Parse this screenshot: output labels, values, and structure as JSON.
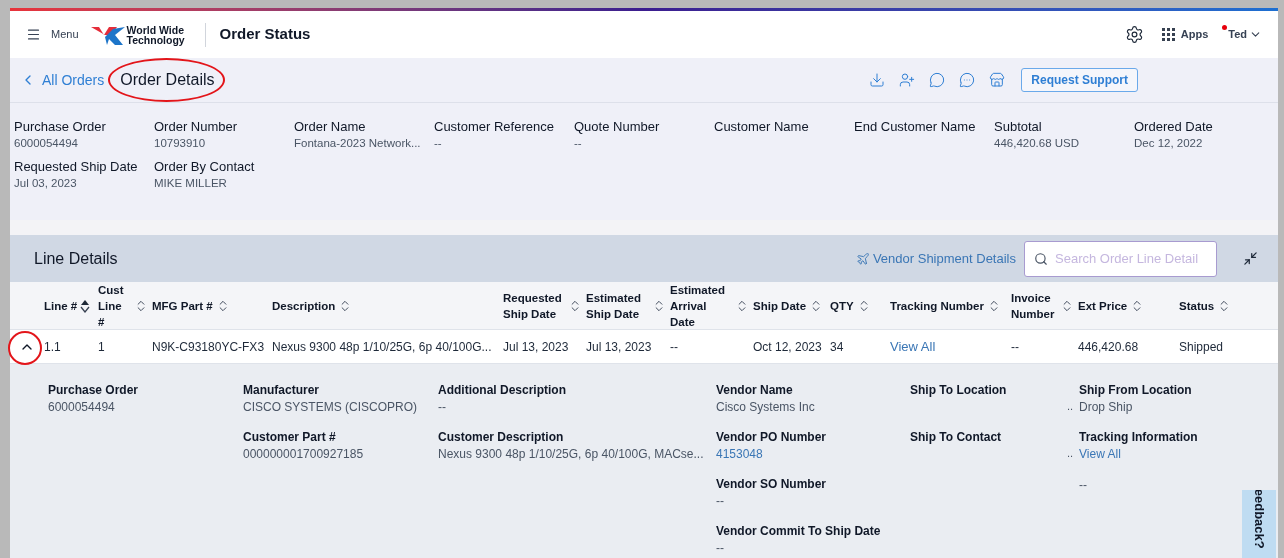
{
  "header": {
    "menu_label": "Menu",
    "logo_text": "World Wide Technology",
    "title": "Order Status",
    "apps_label": "Apps",
    "user": "Ted",
    "notification": true
  },
  "breadcrumb": {
    "back_link": "All Orders",
    "current": "Order Details",
    "annotated": true
  },
  "toolbar": {
    "button": "Request Support"
  },
  "order_fields": [
    {
      "label": "Purchase Order",
      "value": "6000054494"
    },
    {
      "label": "Order Number",
      "value": "10793910"
    },
    {
      "label": "Order Name",
      "value": "Fontana-2023 Network..."
    },
    {
      "label": "Customer Reference",
      "value": "--"
    },
    {
      "label": "Quote Number",
      "value": "--"
    },
    {
      "label": "Customer Name"
    },
    {
      "label": "End Customer Name"
    },
    {
      "label": "Subtotal",
      "value": "446,420.68 USD"
    },
    {
      "label": "Ordered Date",
      "value": "Dec 12, 2022"
    },
    {
      "label": "Requested Ship Date",
      "value": "Jul 03, 2023"
    },
    {
      "label": "Order By Contact",
      "value": "MIKE MILLER"
    }
  ],
  "line_details": {
    "title": "Line Details",
    "vendor_link": "Vendor Shipment Details",
    "search_placeholder": "Search Order Line Detail",
    "columns": [
      {
        "label": "Line #",
        "sorted": true
      },
      {
        "label": "Cust Line #",
        "sorted": false
      },
      {
        "label": "MFG Part #",
        "sorted": false
      },
      {
        "label": "Description",
        "sorted": false
      },
      {
        "label": "Requested Ship Date",
        "sorted": false
      },
      {
        "label": "Estimated Ship Date",
        "sorted": false
      },
      {
        "label": "Estimated Arrival Date",
        "sorted": false
      },
      {
        "label": "Ship Date",
        "sorted": false
      },
      {
        "label": "QTY",
        "sorted": false
      },
      {
        "label": "Tracking Number",
        "sorted": false
      },
      {
        "label": "Invoice Number",
        "sorted": false
      },
      {
        "label": "Ext Price",
        "sorted": false
      },
      {
        "label": "Status",
        "sorted": false
      }
    ],
    "rows": [
      {
        "expanded": true,
        "annotated": true,
        "cells": [
          {
            "text": "1.1"
          },
          {
            "text": "1"
          },
          {
            "text": "N9K-C93180YC-FX3"
          },
          {
            "text": "Nexus 9300 48p 1/10/25G, 6p 40/100G..."
          },
          {
            "text": "Jul 13, 2023"
          },
          {
            "text": "Jul 13, 2023"
          },
          {
            "text": "--"
          },
          {
            "text": "Oct 12, 2023"
          },
          {
            "text": "34"
          },
          {
            "text": "View All",
            "kind": "link"
          },
          {
            "text": "--"
          },
          {
            "text": "446,420.68"
          },
          {
            "text": "Shipped"
          }
        ]
      }
    ],
    "detail_columns": [
      [
        {
          "label": "Purchase Order",
          "value": "6000054494"
        }
      ],
      [
        {
          "label": "Manufacturer",
          "value": "CISCO SYSTEMS (CISCOPRO)"
        },
        {
          "label": "Customer Part #",
          "value": "000000001700927185"
        }
      ],
      [
        {
          "label": "Additional Description",
          "value": "--"
        },
        {
          "label": "Customer Description",
          "value": "Nexus 9300 48p 1/10/25G, 6p 40/100G, MACse..."
        }
      ],
      [
        {
          "label": "Vendor Name",
          "value": "Cisco Systems Inc"
        },
        {
          "label": "Vendor PO Number",
          "value": "4153048",
          "kind": "link"
        },
        {
          "label": "Vendor SO Number",
          "value": "--"
        },
        {
          "label": "Vendor Commit To Ship Date",
          "value": "--"
        }
      ],
      [
        {
          "label": "Ship To Location"
        },
        {
          "label": "Ship To Contact"
        }
      ],
      [
        {
          "label": "Ship From Location",
          "value": "Drop Ship",
          "leader": ".."
        },
        {
          "label": "Tracking Information",
          "value": "View All",
          "kind": "link",
          "leader": ".."
        },
        {
          "value": "--"
        }
      ]
    ]
  },
  "feedback_tab": "eedback?"
}
